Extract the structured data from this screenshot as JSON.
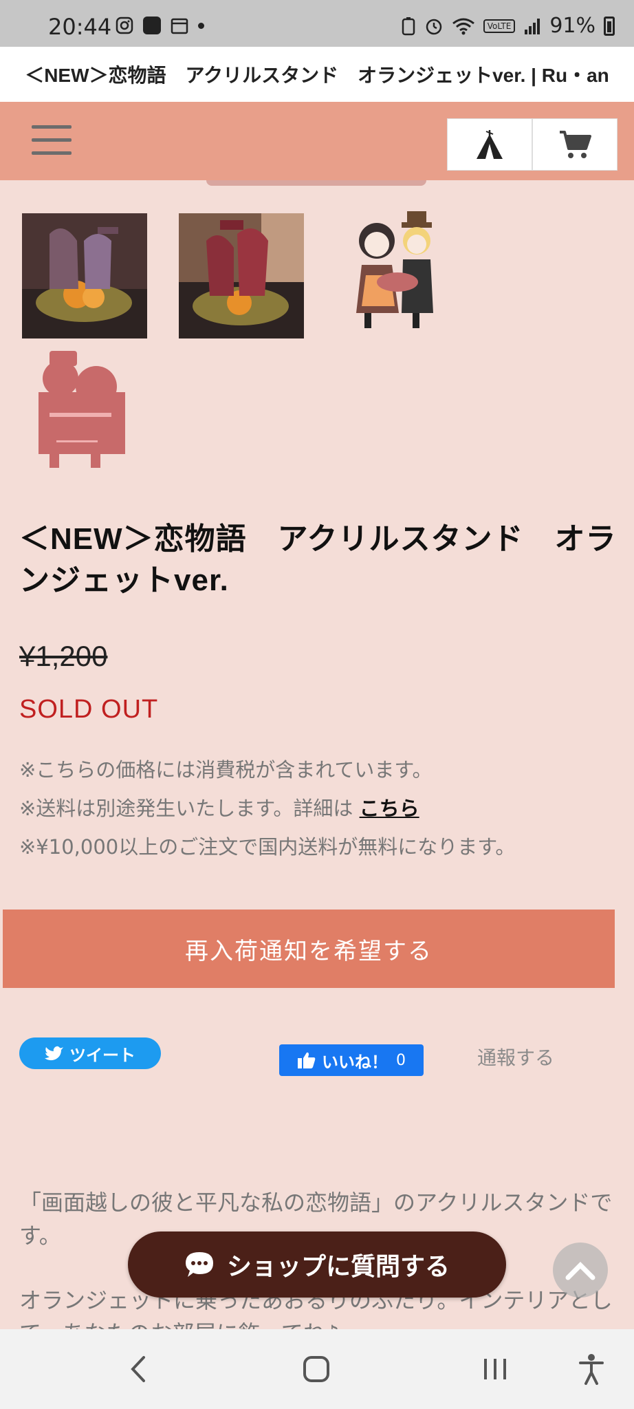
{
  "status_bar": {
    "time": "20:44",
    "line_badge": "LINE\nマンガ",
    "volte": "VoLTE",
    "battery": "91%"
  },
  "page_title_bar": "＜NEW＞恋物語　アクリルスタンド　オランジェットver. | Ru・an",
  "header": {
    "menu_icon": "hamburger-icon",
    "home_icon": "tent-icon",
    "cart_icon": "cart-icon"
  },
  "product": {
    "title": "＜NEW＞恋物語　アクリルスタンド　オランジェットver.",
    "price": "¥1,200",
    "status": "SOLD OUT",
    "notes": {
      "tax": "※こちらの価格には消費税が含まれています。",
      "shipping_prefix": "※送料は別途発生いたします。詳細は ",
      "shipping_link": "こちら",
      "free_shipping": "※¥10,000以上のご注文で国内送料が無料になります。"
    },
    "restock_button": "再入荷通知を希望する"
  },
  "social": {
    "tweet": "ツイート",
    "like": "いいね！",
    "like_count": "0",
    "report": "通報する"
  },
  "description": {
    "line1": "「画面越しの彼と平凡な私の恋物語」のアクリルスタンドです。",
    "line2": "オランジェットに乗ったあおるりのふたり。インテリアとして、あなたのお部屋に飾ってね♪"
  },
  "floating": {
    "ask_shop": "ショップに質問する"
  },
  "colors": {
    "page_bg": "#f4ddd7",
    "header_bg": "#e89f8a",
    "restock_bg": "#e07e66",
    "sold_out": "#c02020",
    "ask_bg": "#4b2018"
  }
}
